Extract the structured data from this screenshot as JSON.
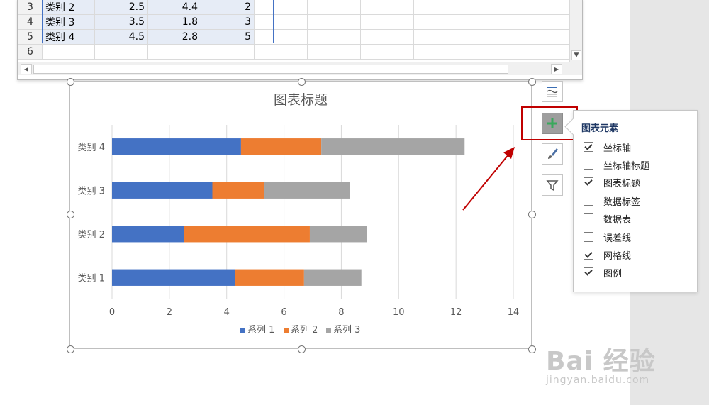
{
  "spreadsheet": {
    "rows": [
      {
        "num": "3",
        "cat": "类别 2",
        "v1": "2.5",
        "v2": "4.4",
        "v3": "2"
      },
      {
        "num": "4",
        "cat": "类别 3",
        "v1": "3.5",
        "v2": "1.8",
        "v3": "3"
      },
      {
        "num": "5",
        "cat": "类别 4",
        "v1": "4.5",
        "v2": "2.8",
        "v3": "5"
      },
      {
        "num": "6",
        "cat": "",
        "v1": "",
        "v2": "",
        "v3": ""
      }
    ]
  },
  "chart_data": {
    "type": "bar",
    "orientation": "horizontal",
    "stacked": true,
    "title": "图表标题",
    "categories": [
      "类别 1",
      "类别 2",
      "类别 3",
      "类别 4"
    ],
    "series": [
      {
        "name": "系列 1",
        "values": [
          4.3,
          2.5,
          3.5,
          4.5
        ],
        "color": "#4472c4"
      },
      {
        "name": "系列 2",
        "values": [
          2.4,
          4.4,
          1.8,
          2.8
        ],
        "color": "#ed7d31"
      },
      {
        "name": "系列 3",
        "values": [
          2.0,
          2.0,
          3.0,
          5.0
        ],
        "color": "#a5a5a5"
      }
    ],
    "xlim": [
      0,
      14
    ],
    "xticks": [
      "0",
      "2",
      "4",
      "6",
      "8",
      "10",
      "12",
      "14"
    ],
    "grid": true,
    "legend": "bottom"
  },
  "side_buttons": {
    "layout_icon": "chart-layout-icon",
    "add_icon": "plus-icon",
    "style_icon": "brush-icon",
    "filter_icon": "filter-icon",
    "highlight_color": "#c00000"
  },
  "chart_elements_panel": {
    "title": "图表元素",
    "options": [
      {
        "label": "坐标轴",
        "checked": true
      },
      {
        "label": "坐标轴标题",
        "checked": false
      },
      {
        "label": "图表标题",
        "checked": true
      },
      {
        "label": "数据标签",
        "checked": false
      },
      {
        "label": "数据表",
        "checked": false
      },
      {
        "label": "误差线",
        "checked": false
      },
      {
        "label": "网格线",
        "checked": true
      },
      {
        "label": "图例",
        "checked": true
      }
    ]
  },
  "watermark": {
    "brand": "Bai 经验",
    "url": "jingyan.baidu.com"
  }
}
